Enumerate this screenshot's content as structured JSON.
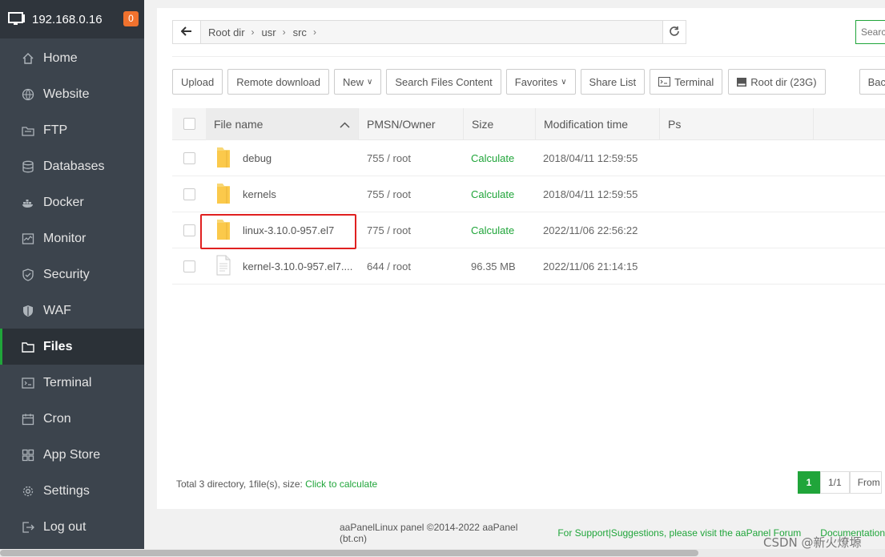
{
  "server": {
    "ip": "192.168.0.16",
    "badge": "0"
  },
  "sidebar": {
    "items": [
      {
        "label": "Home",
        "icon": "home-icon"
      },
      {
        "label": "Website",
        "icon": "globe-icon"
      },
      {
        "label": "FTP",
        "icon": "ftp-icon"
      },
      {
        "label": "Databases",
        "icon": "database-icon"
      },
      {
        "label": "Docker",
        "icon": "docker-icon"
      },
      {
        "label": "Monitor",
        "icon": "monitor-icon"
      },
      {
        "label": "Security",
        "icon": "shield-icon"
      },
      {
        "label": "WAF",
        "icon": "waf-shield-icon"
      },
      {
        "label": "Files",
        "icon": "folder-icon",
        "active": true
      },
      {
        "label": "Terminal",
        "icon": "terminal-icon"
      },
      {
        "label": "Cron",
        "icon": "calendar-icon"
      },
      {
        "label": "App Store",
        "icon": "grid-icon"
      },
      {
        "label": "Settings",
        "icon": "gear-icon"
      },
      {
        "label": "Log out",
        "icon": "logout-icon"
      }
    ]
  },
  "pathbar": {
    "crumbs": [
      "Root dir",
      "usr",
      "src"
    ]
  },
  "search": {
    "placeholder": "Search"
  },
  "toolbar": {
    "upload": "Upload",
    "remote_download": "Remote download",
    "new": "New",
    "search_content": "Search Files Content",
    "favorites": "Favorites",
    "share_list": "Share List",
    "terminal": "Terminal",
    "root_dir": "Root dir (23G)",
    "back": "Back"
  },
  "table": {
    "headers": {
      "name": "File name",
      "owner": "PMSN/Owner",
      "size": "Size",
      "modified": "Modification time",
      "ps": "Ps"
    },
    "rows": [
      {
        "name": "debug",
        "type": "folder",
        "owner": "755 / root",
        "size": "Calculate",
        "modified": "2018/04/11 12:59:55"
      },
      {
        "name": "kernels",
        "type": "folder",
        "owner": "755 / root",
        "size": "Calculate",
        "modified": "2018/04/11 12:59:55"
      },
      {
        "name": "linux-3.10.0-957.el7",
        "type": "folder",
        "owner": "775 / root",
        "size": "Calculate",
        "modified": "2022/11/06 22:56:22",
        "highlighted": true
      },
      {
        "name": "kernel-3.10.0-957.el7....",
        "type": "file",
        "owner": "644 / root",
        "size": "96.35 MB",
        "modified": "2022/11/06 21:14:15"
      }
    ]
  },
  "footer": {
    "summary": "Total 3 directory, 1file(s), size: ",
    "calc_link": "Click to calculate",
    "page_current": "1",
    "page_total": "1/1",
    "page_from": "From"
  },
  "copyright": {
    "text": "aaPanelLinux panel ©2014-2022 aaPanel (bt.cn)",
    "support": "For Support|Suggestions, please visit the aaPanel Forum",
    "docs": "Documentation"
  },
  "watermark": "CSDN @新火燎塬"
}
